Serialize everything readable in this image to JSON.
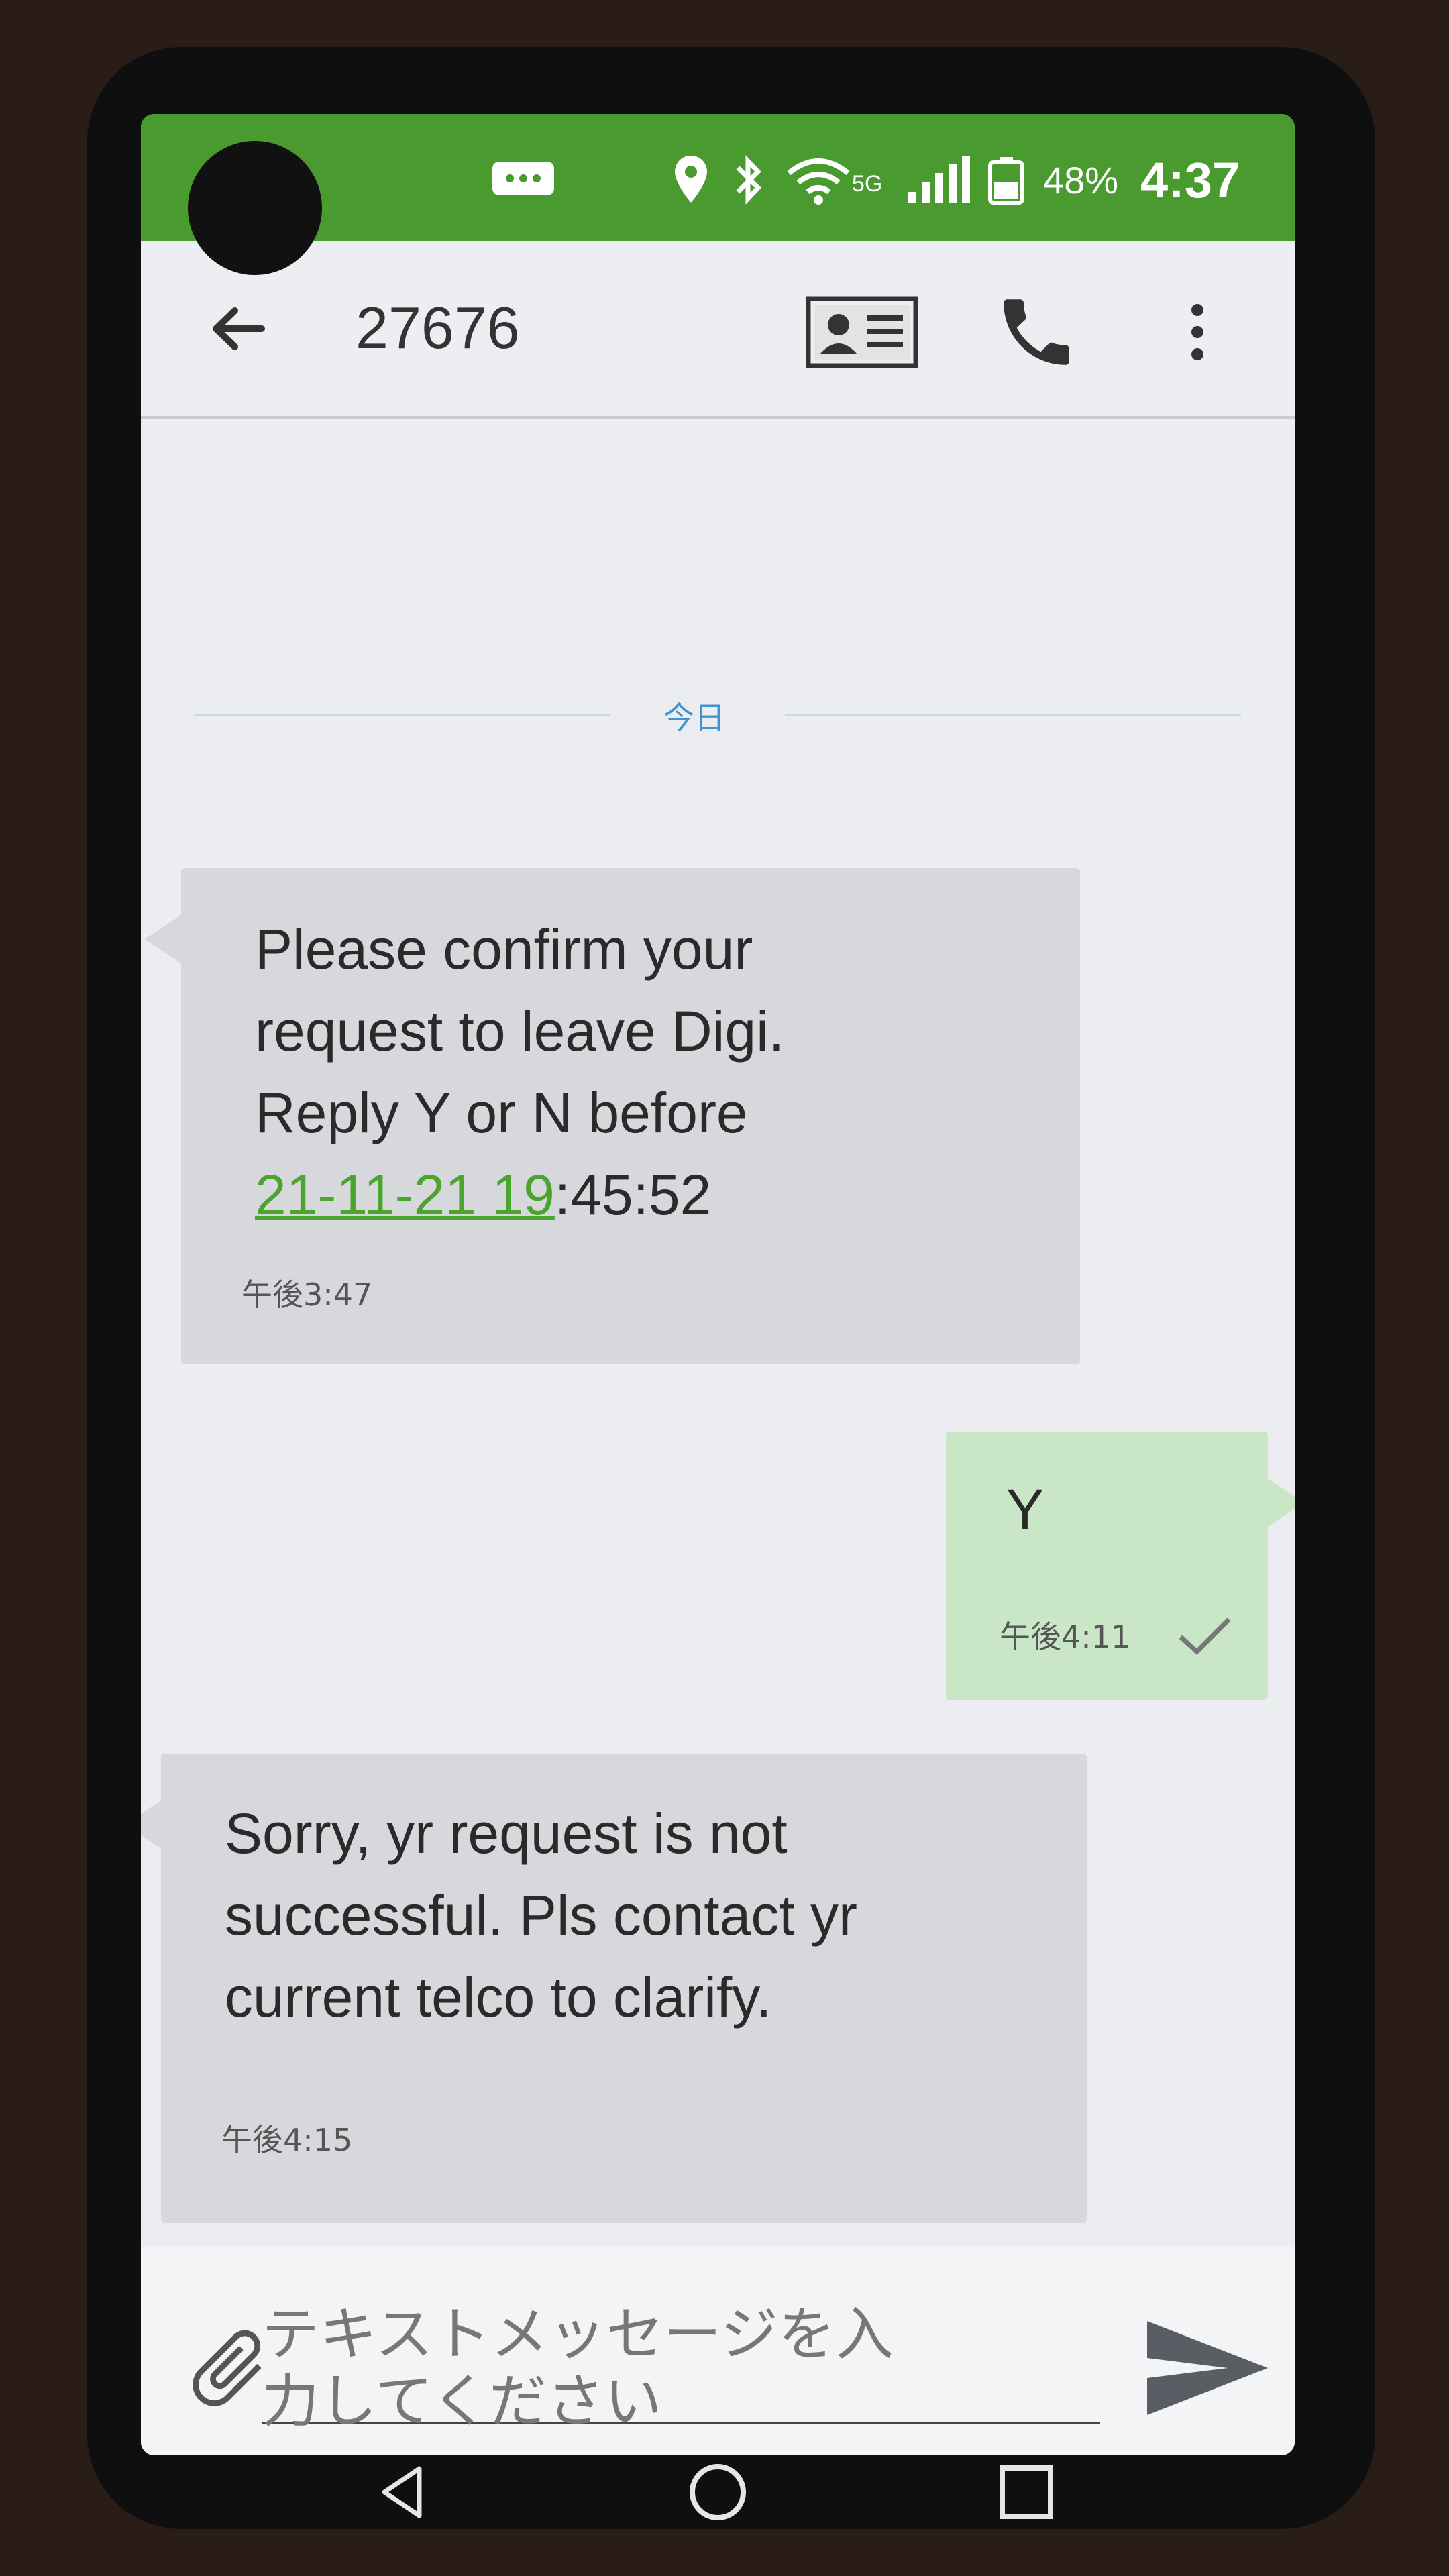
{
  "status_bar": {
    "network": "5G",
    "battery": "48%",
    "time": "4:37",
    "icons": [
      "message-icon",
      "location-icon",
      "bluetooth-icon",
      "wifi-icon",
      "signal-icon",
      "battery-icon"
    ]
  },
  "app_bar": {
    "title": "27676",
    "icons": [
      "back-arrow-icon",
      "contact-card-icon",
      "phone-icon",
      "more-vert-icon"
    ]
  },
  "conversation": {
    "date_divider": "今日",
    "messages": [
      {
        "direction": "incoming",
        "lines": [
          "Please confirm your",
          "request to leave Digi.",
          "Reply Y or N before"
        ],
        "link_text": "21-11-21 19",
        "after_link": ":45:52",
        "time": "午後3:47"
      },
      {
        "direction": "outgoing",
        "text": "Y",
        "time": "午後4:11",
        "status_icon": "check-icon"
      },
      {
        "direction": "incoming",
        "lines": [
          "Sorry, yr request is not",
          "successful. Pls contact yr",
          "current telco to clarify."
        ],
        "time": "午後4:15"
      }
    ]
  },
  "compose": {
    "placeholder_lines": [
      "テキストメッセージを入",
      "力してください"
    ]
  },
  "colors": {
    "status_bar": "#4a9b2f",
    "incoming_bubble": "#d7d8dc",
    "outgoing_bubble": "#c9e7c6",
    "link": "#4aa52e",
    "date_label": "#3f95d1"
  }
}
